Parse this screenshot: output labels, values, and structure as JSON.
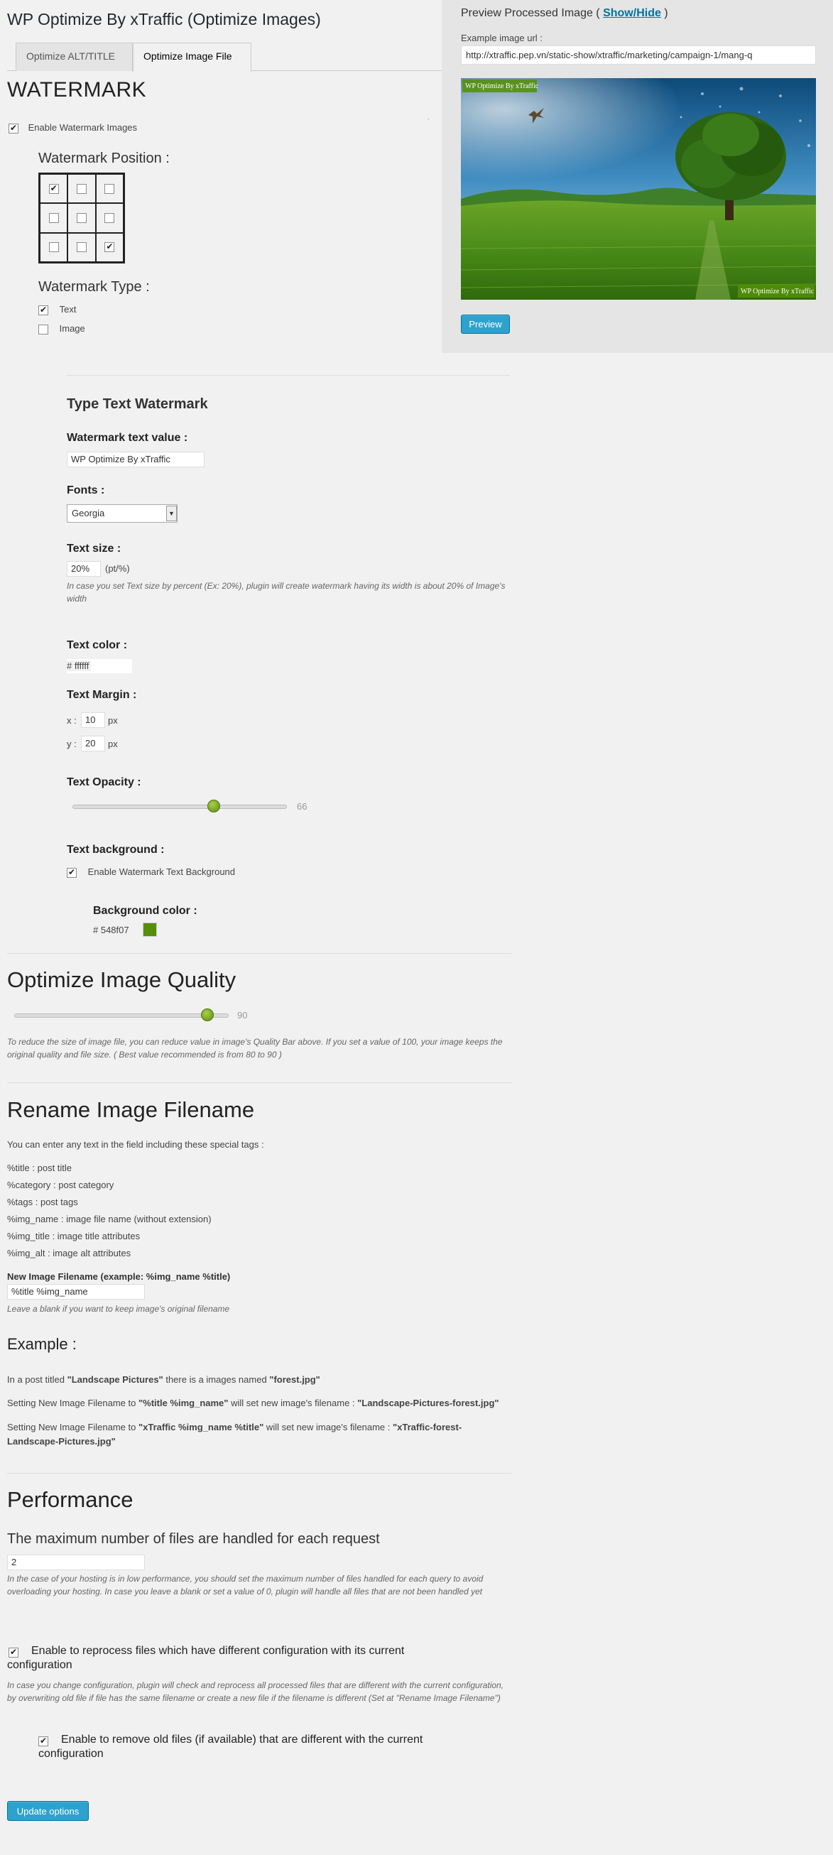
{
  "page": {
    "title": "WP Optimize By xTraffic (Optimize Images)"
  },
  "tabs": [
    {
      "label": "Optimize ALT/TITLE"
    },
    {
      "label": "Optimize Image File"
    }
  ],
  "watermark": {
    "heading": "WATERMARK",
    "enable_label": "Enable Watermark Images",
    "enabled": true,
    "position_label": "Watermark Position :",
    "positions_checked": [
      true,
      false,
      false,
      false,
      false,
      false,
      false,
      false,
      true
    ],
    "type_label": "Watermark Type :",
    "type_text_label": "Text",
    "type_image_label": "Image",
    "type_text_checked": true,
    "type_image_checked": false
  },
  "text_watermark": {
    "heading": "Type Text Watermark",
    "text_value_label": "Watermark text value :",
    "text_value": "WP Optimize By xTraffic",
    "fonts_label": "Fonts :",
    "font_selected": "Georgia",
    "text_size_label": "Text size :",
    "text_size_value": "20%",
    "text_size_unit": "(pt/%)",
    "text_size_hint": "In case you set Text size by percent (Ex: 20%), plugin will create watermark having its width is about 20% of Image's width",
    "text_color_label": "Text color :",
    "text_color_value": "# ffffff",
    "text_margin_label": "Text Margin :",
    "margin_x_label": "x :",
    "margin_x_value": "10",
    "margin_y_label": "y :",
    "margin_y_value": "20",
    "margin_unit": "px",
    "opacity_label": "Text Opacity :",
    "opacity_value": 66,
    "opacity_value_text": "66",
    "background_label": "Text background :",
    "background_enable_label": "Enable Watermark Text Background",
    "background_enabled": true,
    "bg_color_label": "Background color :",
    "bg_color_value": "# 548f07",
    "bg_color_hex": "#548f07"
  },
  "quality": {
    "heading": "Optimize Image Quality",
    "value": 90,
    "value_text": "90",
    "hint": "To reduce the size of image file, you can reduce value in image's Quality Bar above. If you set a value of 100, your image keeps the original quality and file size. ( Best value recommended is from 80 to 90 )"
  },
  "rename": {
    "heading": "Rename Image Filename",
    "intro": "You can enter any text in the field including these special tags :",
    "tags": [
      "%title : post title",
      "%category : post category",
      "%tags : post tags",
      "%img_name : image file name (without extension)",
      "%img_title : image title attributes",
      "%img_alt : image alt attributes"
    ],
    "field_label": "New Image Filename (example: %img_name %title)",
    "field_value": "%title %img_name",
    "field_hint": "Leave a blank if you want to keep image's original filename"
  },
  "example": {
    "heading": "Example :",
    "line1_pre": "In a post titled ",
    "line1_b1": "\"Landscape Pictures\"",
    "line1_mid": " there is a images named ",
    "line1_b2": "\"forest.jpg\"",
    "line2_pre": "Setting New Image Filename to ",
    "line2_b1": "\"%title %img_name\"",
    "line2_mid": " will set new image's filename : ",
    "line2_b2": "\"Landscape-Pictures-forest.jpg\"",
    "line3_pre": "Setting New Image Filename to ",
    "line3_b1": "\"xTraffic %img_name %title\"",
    "line3_mid": " will set new image's filename : ",
    "line3_b2": "\"xTraffic-forest-Landscape-Pictures.jpg\""
  },
  "performance": {
    "heading": "Performance",
    "max_files_label": "The maximum number of files are handled for each request",
    "max_files_value": "2",
    "max_files_hint": "In the case of your hosting is in low performance, you should set the maximum number of files handled for each query to avoid overloading your hosting. In case you leave a blank or set a value of 0, plugin will handle all files that are not been handled yet",
    "reprocess_label": "Enable to reprocess files which have different configuration with its current configuration",
    "reprocess_checked": true,
    "reprocess_hint": "In case you change configuration, plugin will check and reprocess all processed files that are different with the current configuration, by overwriting old file if file has the same filename or create a new file if the filename is different (Set at \"Rename Image Filename\")",
    "remove_old_label": "Enable to remove old files (if available) that are different with the current configuration",
    "remove_old_checked": true
  },
  "update_button": "Update options",
  "preview": {
    "title_pre": "Preview Processed Image ( ",
    "toggle_link": "Show/Hide",
    "title_post": " )",
    "url_label": "Example image url :",
    "url_value": "http://xtraffic.pep.vn/static-show/xtraffic/marketing/campaign-1/mang-q",
    "watermark_top_left": "WP Optimize By xTraffic",
    "watermark_bottom_right": "WP Optimize By xTraffic",
    "button": "Preview"
  },
  "colors": {
    "accent_blue": "#2ea2cc",
    "slider_green": "#6b9b1a"
  }
}
